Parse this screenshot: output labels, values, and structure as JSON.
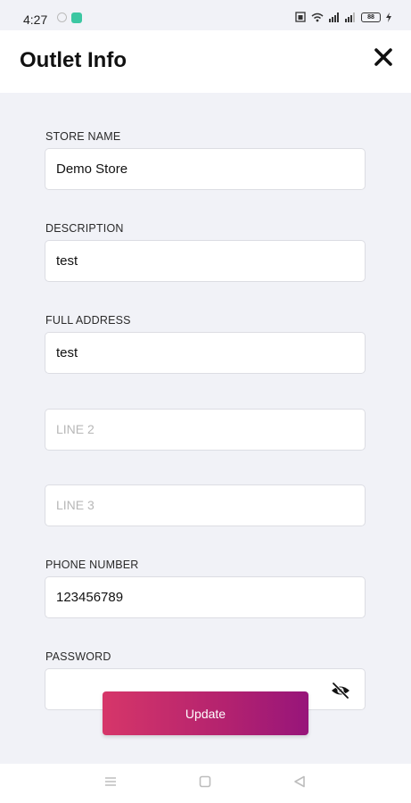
{
  "status": {
    "time": "4:27",
    "battery": "88"
  },
  "header": {
    "title": "Outlet Info"
  },
  "form": {
    "store_name": {
      "label": "STORE NAME",
      "value": "Demo Store"
    },
    "description": {
      "label": "DESCRIPTION",
      "value": "test"
    },
    "full_address": {
      "label": "FULL ADDRESS",
      "value": "test"
    },
    "line2": {
      "placeholder": "LINE 2"
    },
    "line3": {
      "placeholder": "LINE 3"
    },
    "phone": {
      "label": "PHONE NUMBER",
      "value": "123456789"
    },
    "password": {
      "label": "PASSWORD",
      "value": ""
    }
  },
  "actions": {
    "update_label": "Update"
  }
}
